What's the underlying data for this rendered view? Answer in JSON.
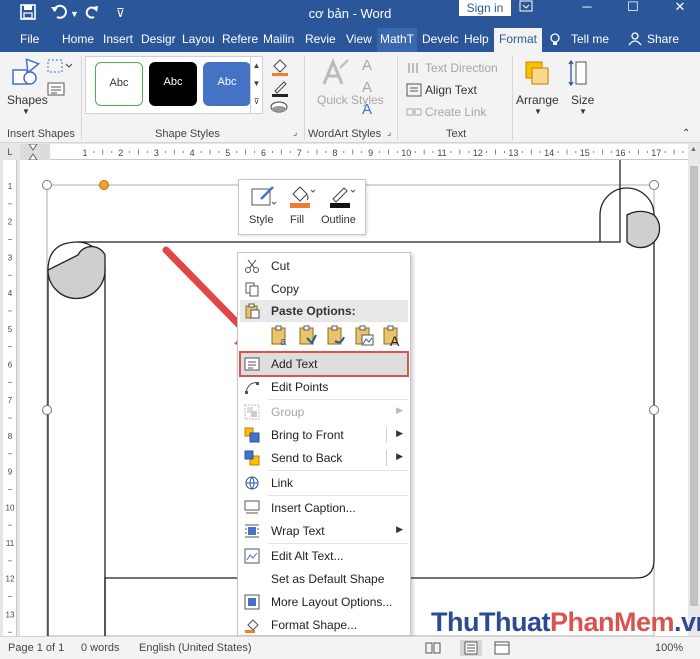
{
  "titlebar": {
    "doc_title": "cơ bản  -  Word",
    "sign_in": "Sign in",
    "format_context": "Format",
    "minimize_glyph": "─",
    "restore_glyph": "☐",
    "close_glyph": "✕",
    "save_icon": "floppy-disk-icon",
    "undo_icon": "undo-icon",
    "redo_icon": "redo-icon"
  },
  "tabs": [
    {
      "label": "File"
    },
    {
      "label": "Home"
    },
    {
      "label": "Insert"
    },
    {
      "label": "Desigr"
    },
    {
      "label": "Layou"
    },
    {
      "label": "Refere"
    },
    {
      "label": "Mailin"
    },
    {
      "label": "Revie"
    },
    {
      "label": "View"
    },
    {
      "label": "MathT"
    },
    {
      "label": "Develc"
    },
    {
      "label": "Help"
    },
    {
      "label": "Format"
    }
  ],
  "tell_me": "Tell me",
  "share": "Share",
  "ribbon": {
    "insert_shapes": {
      "shapes_label": "Shapes",
      "group_label": "Insert Shapes"
    },
    "shape_styles": {
      "samples": [
        "Abc",
        "Abc",
        "Abc"
      ],
      "group_label": "Shape Styles"
    },
    "wordart": {
      "quick_styles": "Quick Styles",
      "group_label": "WordArt Styles",
      "glyph": "A"
    },
    "text": {
      "text_direction": "Text Direction",
      "align_text": "Align Text",
      "create_link": "Create Link",
      "group_label": "Text"
    },
    "arrange": {
      "label": "Arrange"
    },
    "size": {
      "label": "Size"
    }
  },
  "ruler": {
    "numbers": [
      "1",
      "2",
      "3",
      "4",
      "5",
      "6",
      "7",
      "8",
      "9",
      "10",
      "11",
      "12",
      "13",
      "14",
      "15",
      "16",
      "17"
    ],
    "vertical_numbers": [
      "1",
      "2",
      "3",
      "4",
      "5",
      "6",
      "7",
      "8",
      "9",
      "10",
      "11",
      "12",
      "13"
    ]
  },
  "mini_toolbar": {
    "style": "Style",
    "fill": "Fill",
    "outline": "Outline"
  },
  "context_menu": {
    "cut": "Cut",
    "copy": "Copy",
    "paste_options": "Paste Options:",
    "add_text": "Add Text",
    "edit_points": "Edit Points",
    "group": "Group",
    "bring_to_front": "Bring to Front",
    "send_to_back": "Send to Back",
    "link": "Link",
    "insert_caption": "Insert Caption...",
    "wrap_text": "Wrap Text",
    "edit_alt_text": "Edit Alt Text...",
    "set_default_shape": "Set as Default Shape",
    "more_layout_options": "More Layout Options...",
    "format_shape": "Format Shape..."
  },
  "status_bar": {
    "page": "Page 1 of 1",
    "words": "0 words",
    "language": "English (United States)",
    "zoom": "100%"
  },
  "watermark": {
    "part1": "Thu",
    "part2": "Thuat",
    "part3": "PhanMem",
    "part4": ".vn"
  },
  "colors": {
    "word_blue": "#2b579a",
    "highlight_red": "#d9534f",
    "fill_orange": "#ed7d31",
    "shape_blue": "#4472c4"
  }
}
